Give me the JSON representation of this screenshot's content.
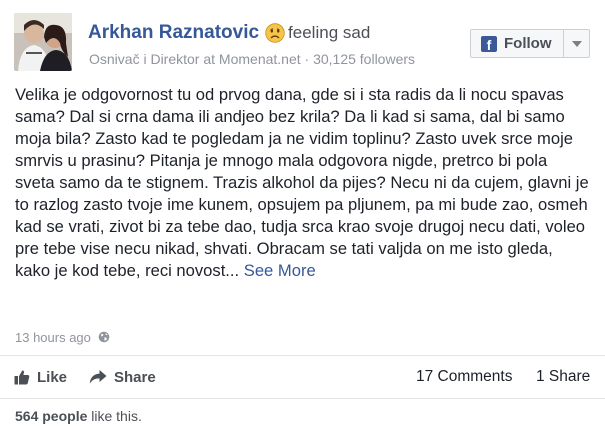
{
  "post": {
    "author": "Arkhan Raznatovic",
    "feeling": "feeling sad",
    "feeling_icon": "sad-face-emoji",
    "subtitle": "Osnivač i Direktor at Momenat.net · 30,125 followers",
    "follow_label": "Follow",
    "body": "Velika je odgovornost tu od prvog dana, gde si i sta radis da li nocu spavas sama? Dal si crna dama ili andjeo bez krila? Da li kad si sama, dal bi samo moja bila? Zasto kad te pogledam ja ne vidim toplinu? Zasto uvek srce moje smrvis u prasinu? Pitanja je mnogo mala odgovora nigde, pretrco bi pola sveta samo da te stignem. Trazis alkohol da pijes? Necu ni da cujem, glavni je to razlog zasto tvoje ime kunem, opsujem pa pljunem, pa mi bude zao, osmeh kad se vrati, zivot bi za tebe dao, tudja srca krao svoje drugoj necu dati, voleo pre tebe vise necu nikad, shvati. Obracam se tati valjda on me isto gleda, kako je kod tebe, reci novost...",
    "see_more": "See More",
    "timestamp": "13 hours ago",
    "privacy_icon": "globe-icon"
  },
  "actions": {
    "like_label": "Like",
    "share_label": "Share",
    "comments_count": "17 Comments",
    "shares_count": "1 Share"
  },
  "likes": {
    "count_text": "564 people",
    "suffix": " like this."
  },
  "colors": {
    "link_blue": "#365899",
    "facebook_blue": "#3b5998",
    "text": "#1d2129",
    "muted": "#90949c",
    "emoji_yellow": "#f7c44a"
  }
}
